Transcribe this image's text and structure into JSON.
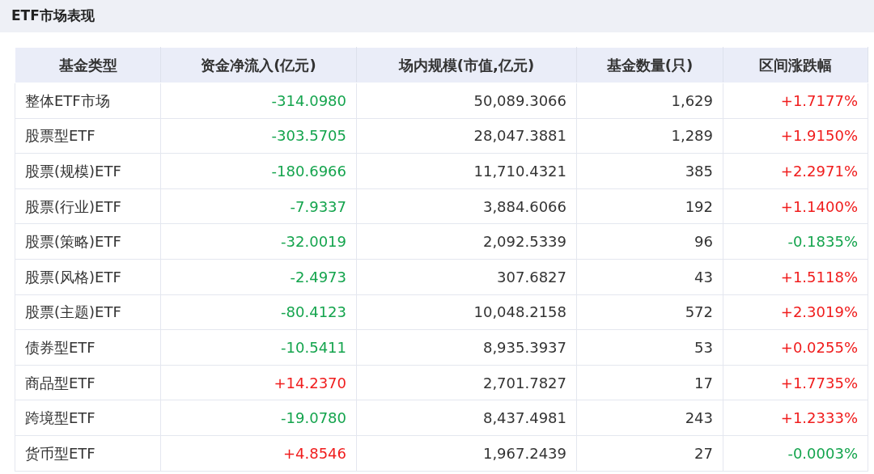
{
  "title": "ETF市场表现",
  "table": {
    "columns": [
      "基金类型",
      "资金净流入(亿元)",
      "场内规模(市值,亿元)",
      "基金数量(只)",
      "区间涨跌幅"
    ],
    "rows": [
      {
        "type": "整体ETF市场",
        "flow": {
          "text": "-314.0980",
          "rising": false
        },
        "scale": "50,089.3066",
        "count": "1,629",
        "change": {
          "text": "+1.7177%",
          "rising": true
        }
      },
      {
        "type": "股票型ETF",
        "flow": {
          "text": "-303.5705",
          "rising": false
        },
        "scale": "28,047.3881",
        "count": "1,289",
        "change": {
          "text": "+1.9150%",
          "rising": true
        }
      },
      {
        "type": "股票(规模)ETF",
        "flow": {
          "text": "-180.6966",
          "rising": false
        },
        "scale": "11,710.4321",
        "count": "385",
        "change": {
          "text": "+2.2971%",
          "rising": true
        }
      },
      {
        "type": "股票(行业)ETF",
        "flow": {
          "text": "-7.9337",
          "rising": false
        },
        "scale": "3,884.6066",
        "count": "192",
        "change": {
          "text": "+1.1400%",
          "rising": true
        }
      },
      {
        "type": "股票(策略)ETF",
        "flow": {
          "text": "-32.0019",
          "rising": false
        },
        "scale": "2,092.5339",
        "count": "96",
        "change": {
          "text": "-0.1835%",
          "rising": false
        }
      },
      {
        "type": "股票(风格)ETF",
        "flow": {
          "text": "-2.4973",
          "rising": false
        },
        "scale": "307.6827",
        "count": "43",
        "change": {
          "text": "+1.5118%",
          "rising": true
        }
      },
      {
        "type": "股票(主题)ETF",
        "flow": {
          "text": "-80.4123",
          "rising": false
        },
        "scale": "10,048.2158",
        "count": "572",
        "change": {
          "text": "+2.3019%",
          "rising": true
        }
      },
      {
        "type": "债券型ETF",
        "flow": {
          "text": "-10.5411",
          "rising": false
        },
        "scale": "8,935.3937",
        "count": "53",
        "change": {
          "text": "+0.0255%",
          "rising": true
        }
      },
      {
        "type": "商品型ETF",
        "flow": {
          "text": "+14.2370",
          "rising": true
        },
        "scale": "2,701.7827",
        "count": "17",
        "change": {
          "text": "+1.7735%",
          "rising": true
        }
      },
      {
        "type": "跨境型ETF",
        "flow": {
          "text": "-19.0780",
          "rising": false
        },
        "scale": "8,437.4981",
        "count": "243",
        "change": {
          "text": "+1.2333%",
          "rising": true
        }
      },
      {
        "type": "货币型ETF",
        "flow": {
          "text": "+4.8546",
          "rising": true
        },
        "scale": "1,967.2439",
        "count": "27",
        "change": {
          "text": "-0.0003%",
          "rising": false
        }
      }
    ]
  }
}
